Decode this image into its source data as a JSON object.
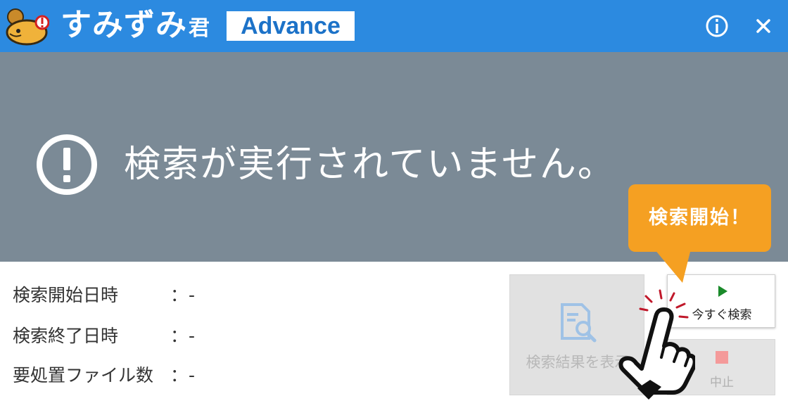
{
  "titlebar": {
    "app_name": "すみずみ",
    "app_name_suffix": "君",
    "edition": "Advance",
    "color": "#2c8ae0",
    "icons": [
      "mouse-mascot-logo",
      "info-icon",
      "close-icon"
    ]
  },
  "status": {
    "message": "検索が実行されていません。",
    "icon": "exclamation-circle-icon",
    "background": "#7b8a96"
  },
  "info": {
    "rows": [
      {
        "label": "検索開始日時",
        "colon": "：",
        "value": "-"
      },
      {
        "label": "検索終了日時",
        "colon": "：",
        "value": "-"
      },
      {
        "label": "要処置ファイル数",
        "colon": "：",
        "value": "-"
      }
    ]
  },
  "buttons": {
    "results_label": "検索結果を表示",
    "results_icon": "document-search-icon",
    "search_now_label": "今すぐ検索",
    "search_now_icon": "play-icon",
    "stop_label": "中止",
    "stop_icon": "stop-icon"
  },
  "callout": {
    "text": "検索開始！",
    "color": "#f5a022"
  }
}
